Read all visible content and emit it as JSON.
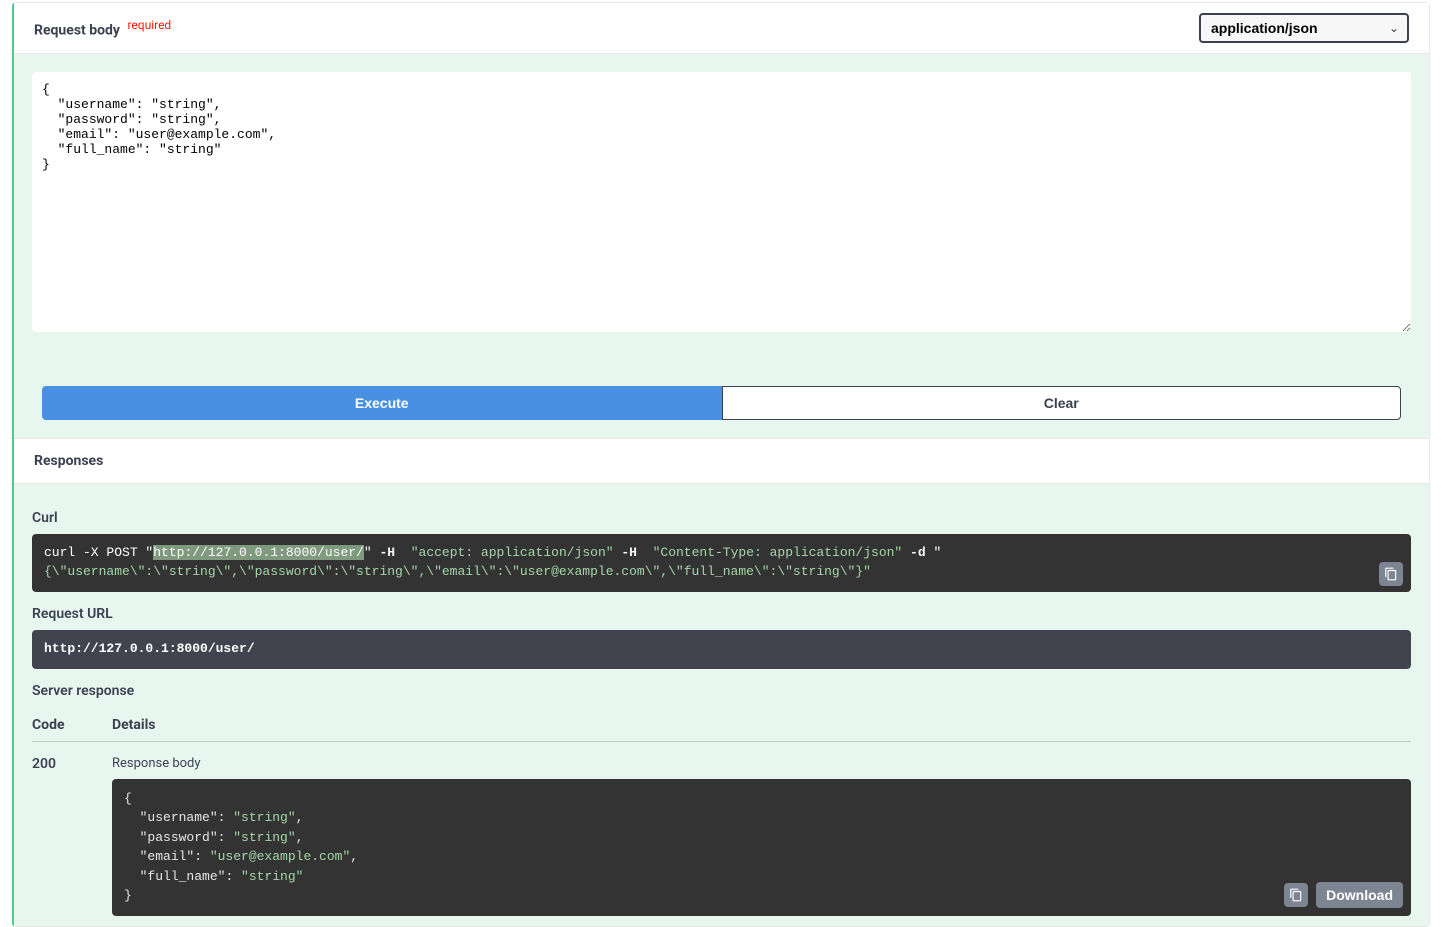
{
  "request_body": {
    "title": "Request body",
    "required_label": "required",
    "content_type": "application/json",
    "payload": "{\n  \"username\": \"string\",\n  \"password\": \"string\",\n  \"email\": \"user@example.com\",\n  \"full_name\": \"string\"\n}"
  },
  "buttons": {
    "execute": "Execute",
    "clear": "Clear"
  },
  "responses": {
    "title": "Responses",
    "curl_label": "Curl",
    "curl_prefix": "curl -X POST ",
    "curl_url": "http://127.0.0.1:8000/user/",
    "curl_h1": "\"accept: application/json\"",
    "curl_h2": "\"Content-Type: application/json\"",
    "curl_body": "{\\\"username\\\":\\\"string\\\",\\\"password\\\":\\\"string\\\",\\\"email\\\":\\\"user@example.com\\\",\\\"full_name\\\":\\\"string\\\"}\"",
    "request_url_label": "Request URL",
    "request_url": "http://127.0.0.1:8000/user/",
    "server_response_label": "Server response",
    "col_code": "Code",
    "col_details": "Details",
    "status_code": "200",
    "response_body_label": "Response body",
    "response_json": {
      "username": "string",
      "password": "string",
      "email": "user@example.com",
      "full_name": "string"
    },
    "download_label": "Download"
  }
}
